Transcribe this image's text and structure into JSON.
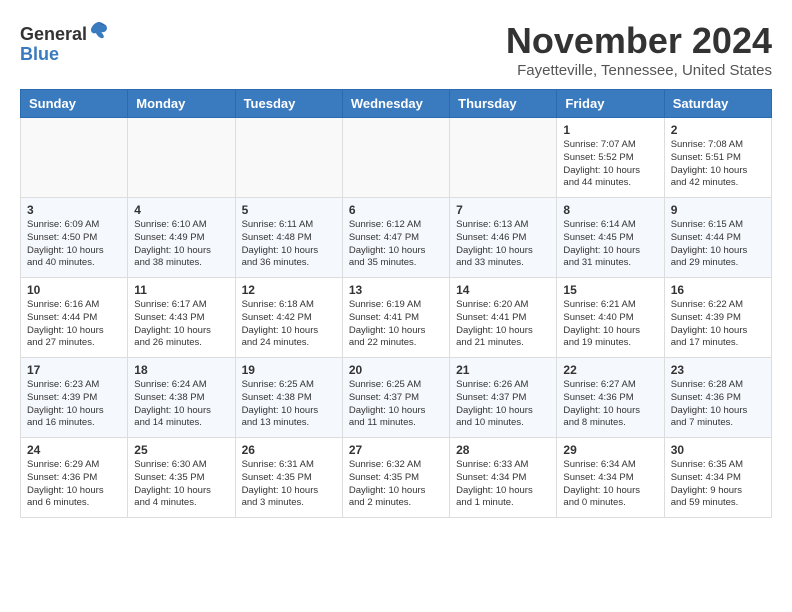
{
  "header": {
    "logo_line1": "General",
    "logo_line2": "Blue",
    "month_title": "November 2024",
    "location": "Fayetteville, Tennessee, United States"
  },
  "days_of_week": [
    "Sunday",
    "Monday",
    "Tuesday",
    "Wednesday",
    "Thursday",
    "Friday",
    "Saturday"
  ],
  "weeks": [
    [
      {
        "day": "",
        "info": ""
      },
      {
        "day": "",
        "info": ""
      },
      {
        "day": "",
        "info": ""
      },
      {
        "day": "",
        "info": ""
      },
      {
        "day": "",
        "info": ""
      },
      {
        "day": "1",
        "info": "Sunrise: 7:07 AM\nSunset: 5:52 PM\nDaylight: 10 hours\nand 44 minutes."
      },
      {
        "day": "2",
        "info": "Sunrise: 7:08 AM\nSunset: 5:51 PM\nDaylight: 10 hours\nand 42 minutes."
      }
    ],
    [
      {
        "day": "3",
        "info": "Sunrise: 6:09 AM\nSunset: 4:50 PM\nDaylight: 10 hours\nand 40 minutes."
      },
      {
        "day": "4",
        "info": "Sunrise: 6:10 AM\nSunset: 4:49 PM\nDaylight: 10 hours\nand 38 minutes."
      },
      {
        "day": "5",
        "info": "Sunrise: 6:11 AM\nSunset: 4:48 PM\nDaylight: 10 hours\nand 36 minutes."
      },
      {
        "day": "6",
        "info": "Sunrise: 6:12 AM\nSunset: 4:47 PM\nDaylight: 10 hours\nand 35 minutes."
      },
      {
        "day": "7",
        "info": "Sunrise: 6:13 AM\nSunset: 4:46 PM\nDaylight: 10 hours\nand 33 minutes."
      },
      {
        "day": "8",
        "info": "Sunrise: 6:14 AM\nSunset: 4:45 PM\nDaylight: 10 hours\nand 31 minutes."
      },
      {
        "day": "9",
        "info": "Sunrise: 6:15 AM\nSunset: 4:44 PM\nDaylight: 10 hours\nand 29 minutes."
      }
    ],
    [
      {
        "day": "10",
        "info": "Sunrise: 6:16 AM\nSunset: 4:44 PM\nDaylight: 10 hours\nand 27 minutes."
      },
      {
        "day": "11",
        "info": "Sunrise: 6:17 AM\nSunset: 4:43 PM\nDaylight: 10 hours\nand 26 minutes."
      },
      {
        "day": "12",
        "info": "Sunrise: 6:18 AM\nSunset: 4:42 PM\nDaylight: 10 hours\nand 24 minutes."
      },
      {
        "day": "13",
        "info": "Sunrise: 6:19 AM\nSunset: 4:41 PM\nDaylight: 10 hours\nand 22 minutes."
      },
      {
        "day": "14",
        "info": "Sunrise: 6:20 AM\nSunset: 4:41 PM\nDaylight: 10 hours\nand 21 minutes."
      },
      {
        "day": "15",
        "info": "Sunrise: 6:21 AM\nSunset: 4:40 PM\nDaylight: 10 hours\nand 19 minutes."
      },
      {
        "day": "16",
        "info": "Sunrise: 6:22 AM\nSunset: 4:39 PM\nDaylight: 10 hours\nand 17 minutes."
      }
    ],
    [
      {
        "day": "17",
        "info": "Sunrise: 6:23 AM\nSunset: 4:39 PM\nDaylight: 10 hours\nand 16 minutes."
      },
      {
        "day": "18",
        "info": "Sunrise: 6:24 AM\nSunset: 4:38 PM\nDaylight: 10 hours\nand 14 minutes."
      },
      {
        "day": "19",
        "info": "Sunrise: 6:25 AM\nSunset: 4:38 PM\nDaylight: 10 hours\nand 13 minutes."
      },
      {
        "day": "20",
        "info": "Sunrise: 6:25 AM\nSunset: 4:37 PM\nDaylight: 10 hours\nand 11 minutes."
      },
      {
        "day": "21",
        "info": "Sunrise: 6:26 AM\nSunset: 4:37 PM\nDaylight: 10 hours\nand 10 minutes."
      },
      {
        "day": "22",
        "info": "Sunrise: 6:27 AM\nSunset: 4:36 PM\nDaylight: 10 hours\nand 8 minutes."
      },
      {
        "day": "23",
        "info": "Sunrise: 6:28 AM\nSunset: 4:36 PM\nDaylight: 10 hours\nand 7 minutes."
      }
    ],
    [
      {
        "day": "24",
        "info": "Sunrise: 6:29 AM\nSunset: 4:36 PM\nDaylight: 10 hours\nand 6 minutes."
      },
      {
        "day": "25",
        "info": "Sunrise: 6:30 AM\nSunset: 4:35 PM\nDaylight: 10 hours\nand 4 minutes."
      },
      {
        "day": "26",
        "info": "Sunrise: 6:31 AM\nSunset: 4:35 PM\nDaylight: 10 hours\nand 3 minutes."
      },
      {
        "day": "27",
        "info": "Sunrise: 6:32 AM\nSunset: 4:35 PM\nDaylight: 10 hours\nand 2 minutes."
      },
      {
        "day": "28",
        "info": "Sunrise: 6:33 AM\nSunset: 4:34 PM\nDaylight: 10 hours\nand 1 minute."
      },
      {
        "day": "29",
        "info": "Sunrise: 6:34 AM\nSunset: 4:34 PM\nDaylight: 10 hours\nand 0 minutes."
      },
      {
        "day": "30",
        "info": "Sunrise: 6:35 AM\nSunset: 4:34 PM\nDaylight: 9 hours\nand 59 minutes."
      }
    ]
  ]
}
